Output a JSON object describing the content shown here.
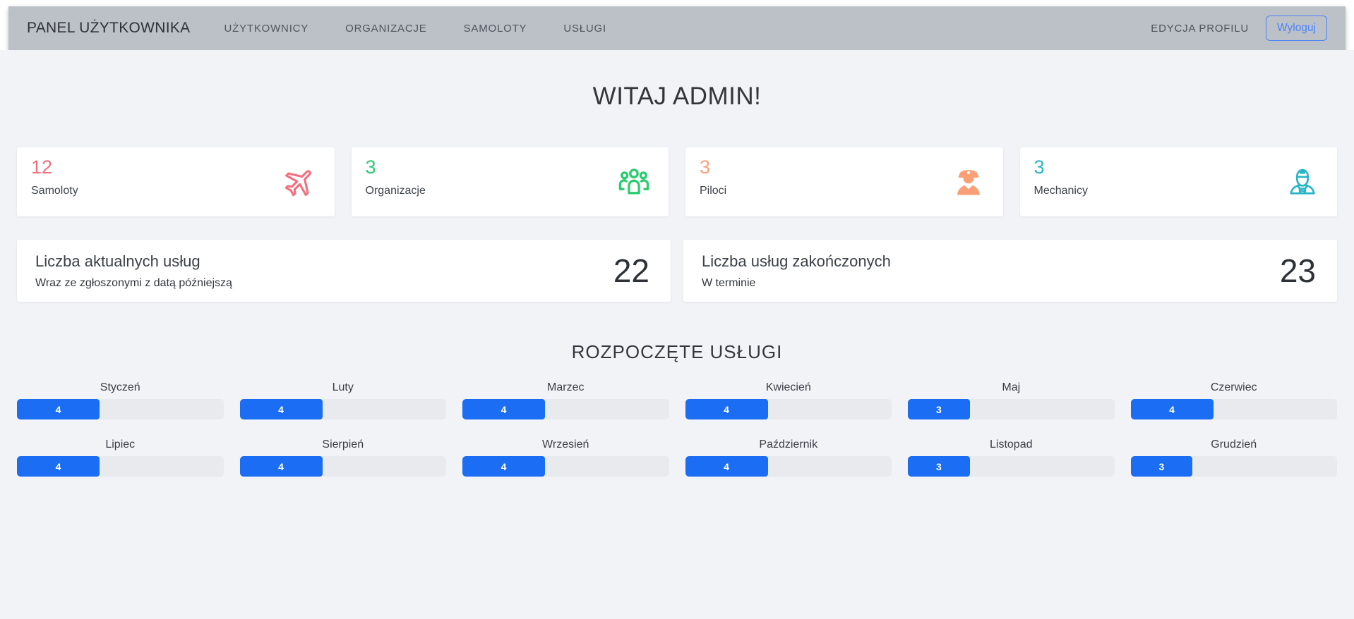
{
  "navbar": {
    "brand": "PANEL UŻYTKOWNIKA",
    "items": [
      {
        "label": "UŻYTKOWNICY"
      },
      {
        "label": "ORGANIZACJE"
      },
      {
        "label": "SAMOLOTY"
      },
      {
        "label": "USŁUGI"
      }
    ],
    "profile_label": "EDYCJA PROFILU",
    "logout_label": "Wyloguj",
    "logout_color": "#4c84f6",
    "bar_color": "#bcc1c8"
  },
  "header": {
    "welcome_title": "WITAJ ADMIN!"
  },
  "stats": {
    "cards": [
      {
        "value": "12",
        "label": "Samoloty",
        "icon": "plane-icon",
        "color": "#f0707f"
      },
      {
        "value": "3",
        "label": "Organizacje",
        "icon": "group-icon",
        "color": "#2acc70"
      },
      {
        "value": "3",
        "label": "Piloci",
        "icon": "pilot-icon",
        "color": "#f9a077"
      },
      {
        "value": "3",
        "label": "Mechanicy",
        "icon": "mechanic-icon",
        "color": "#27b6c6"
      }
    ]
  },
  "summary": {
    "cards": [
      {
        "title": "Liczba aktualnych usług",
        "subtitle": "Wraz ze zgłoszonymi z datą późniejszą",
        "value": "22"
      },
      {
        "title": "Liczba usług zakończonych",
        "subtitle": "W terminie",
        "value": "23"
      }
    ]
  },
  "chart_data": {
    "type": "bar",
    "orientation": "horizontal-progress",
    "title": "ROZPOCZĘTE USŁUGI",
    "categories": [
      "Styczeń",
      "Luty",
      "Marzec",
      "Kwiecień",
      "Maj",
      "Czerwiec",
      "Lipiec",
      "Sierpień",
      "Wrzesień",
      "Październik",
      "Listopad",
      "Grudzień"
    ],
    "values": [
      4,
      4,
      4,
      4,
      3,
      4,
      4,
      4,
      4,
      4,
      3,
      3
    ],
    "max": 10,
    "bar_color": "#1b6ef3",
    "track_color": "#e9eaee",
    "value_labels_shown": true,
    "grid_columns": 6
  },
  "page": {
    "background": "#f1f3f7"
  }
}
